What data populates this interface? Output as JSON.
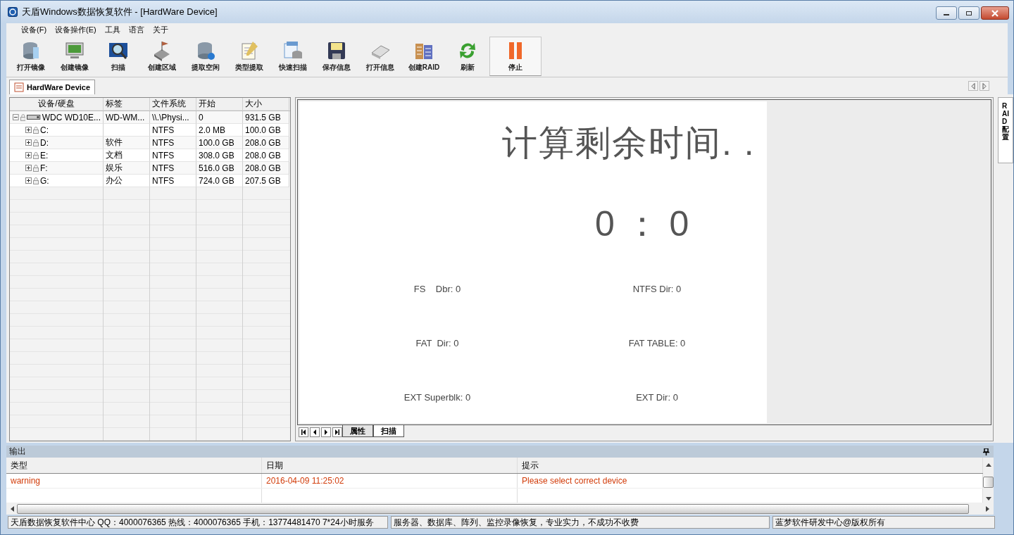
{
  "window": {
    "title": "天盾Windows数据恢复软件 - [HardWare Device]"
  },
  "menu": [
    "设备(F)",
    "设备操作(E)",
    "工具",
    "语言",
    "关于"
  ],
  "toolbar": [
    {
      "label": "打开镜像",
      "pressed": false
    },
    {
      "label": "创建镜像",
      "pressed": false
    },
    {
      "label": "扫描",
      "pressed": false
    },
    {
      "label": "创建区域",
      "pressed": false
    },
    {
      "label": "提取空闲",
      "pressed": false
    },
    {
      "label": "类型提取",
      "pressed": false
    },
    {
      "label": "快速扫描",
      "pressed": false
    },
    {
      "label": "保存信息",
      "pressed": false
    },
    {
      "label": "打开信息",
      "pressed": false
    },
    {
      "label": "创建RAID",
      "pressed": false
    },
    {
      "label": "刷新",
      "pressed": false
    },
    {
      "label": "停止",
      "pressed": true
    }
  ],
  "document_tab": {
    "label": "HardWare Device"
  },
  "side_tab": {
    "label": "RAID配置"
  },
  "tree": {
    "columns": [
      "设备/硬盘",
      "标签",
      "文件系统",
      "开始",
      "大小"
    ],
    "rows": [
      {
        "name": "WDC WD10E...",
        "label": "WD-WM...",
        "fs": "\\\\.\\Physi...",
        "start": "0",
        "size": "931.5 GB",
        "expanded": true,
        "children": [
          {
            "name": "C:",
            "fs": "NTFS",
            "start": "2.0 MB",
            "size": "100.0 GB",
            "expanded": false
          },
          {
            "name": "D:",
            "label": "软件",
            "fs": "NTFS",
            "start": "100.0 GB",
            "size": "208.0 GB",
            "expanded": false
          },
          {
            "name": "E:",
            "label": "文档",
            "fs": "NTFS",
            "start": "308.0 GB",
            "size": "208.0 GB",
            "expanded": false
          },
          {
            "name": "F:",
            "label": "娱乐",
            "fs": "NTFS",
            "start": "516.0 GB",
            "size": "208.0 GB",
            "expanded": false
          },
          {
            "name": "G:",
            "label": "办公",
            "fs": "NTFS",
            "start": "724.0 GB",
            "size": "207.5 GB",
            "expanded": false
          }
        ]
      }
    ]
  },
  "scan": {
    "heading": "计算剩余时间. .",
    "timer": "0 ： 0",
    "stats": [
      "FS    Dbr: 0",
      "NTFS Dir: 0",
      "FAT  Dir: 0",
      "FAT TABLE: 0",
      "EXT Superblk: 0",
      "EXT Dir: 0"
    ]
  },
  "bottom_tabs": [
    {
      "label": "属性",
      "selected": false
    },
    {
      "label": "扫描",
      "selected": true
    }
  ],
  "output": {
    "title": "输出",
    "columns": [
      "类型",
      "日期",
      "提示"
    ],
    "rows": [
      [
        "warning",
        "2016-04-09 11:25:02",
        "Please select correct device"
      ]
    ]
  },
  "status_bar": [
    "天盾数据恢复软件中心 QQ：4000076365 热线：4000076365 手机：13774481470   7*24小时服务",
    "服务器、数据库、阵列、监控录像恢复，专业实力，不成功不收费",
    "蓝梦软件研发中心@版权所有"
  ]
}
